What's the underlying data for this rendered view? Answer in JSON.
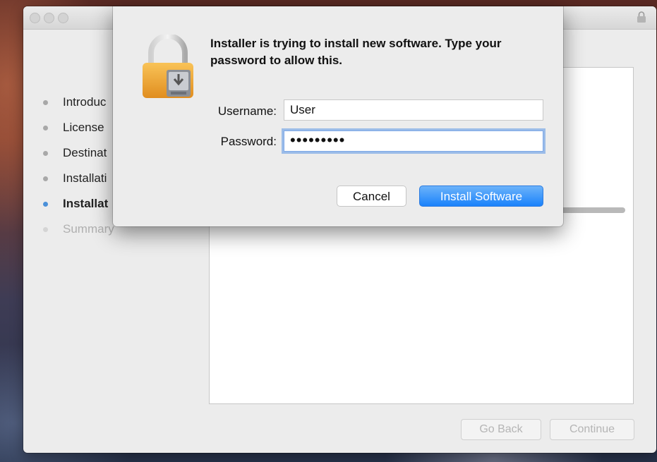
{
  "installer_window": {
    "steps": [
      {
        "label": "Introduc",
        "state": "done"
      },
      {
        "label": "License",
        "state": "done"
      },
      {
        "label": "Destinat",
        "state": "done"
      },
      {
        "label": "Installati",
        "state": "done"
      },
      {
        "label": "Installat",
        "state": "current"
      },
      {
        "label": "Summary",
        "state": "future"
      }
    ],
    "go_back_label": "Go Back",
    "continue_label": "Continue"
  },
  "auth_sheet": {
    "message": "Installer is trying to install new software. Type your password to allow this.",
    "username_label": "Username:",
    "username_value": "User",
    "password_label": "Password:",
    "password_masked": "•••••••••",
    "cancel_label": "Cancel",
    "install_label": "Install Software"
  },
  "icons": {
    "title_lock": "padlock-icon",
    "sheet_lock": "padlock-installer-icon"
  },
  "colors": {
    "accent_blue": "#1a82fb",
    "current_step_dot": "#4a90d9",
    "lock_gold": "#f2a93b"
  }
}
